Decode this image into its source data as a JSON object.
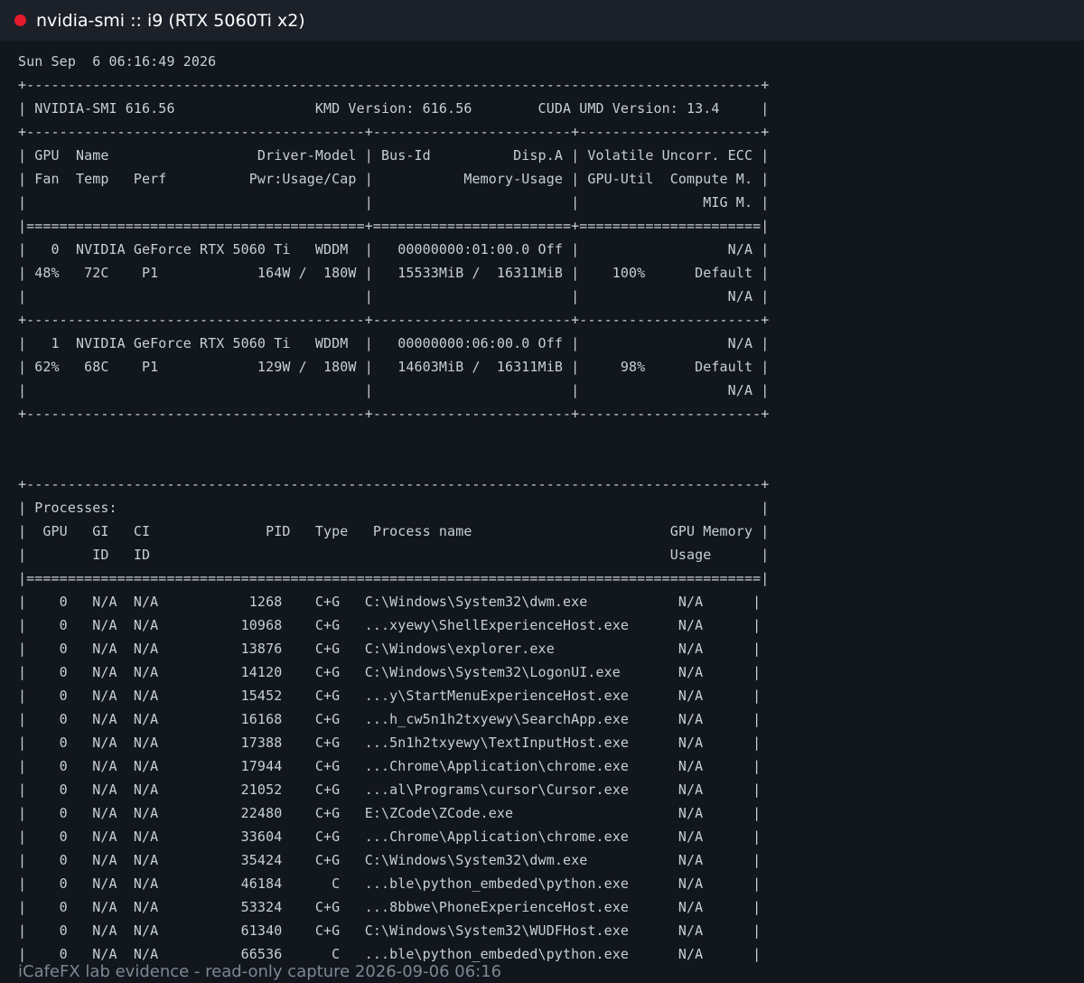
{
  "window": {
    "title": "nvidia-smi :: i9 (RTX 5060Ti x2)"
  },
  "terminal": {
    "lines": [
      "Sun Sep  6 06:16:49 2026",
      "+-----------------------------------------------------------------------------------------+",
      "| NVIDIA-SMI 616.56                 KMD Version: 616.56        CUDA UMD Version: 13.4     |",
      "+-----------------------------------------+------------------------+----------------------+",
      "| GPU  Name                  Driver-Model | Bus-Id          Disp.A | Volatile Uncorr. ECC |",
      "| Fan  Temp   Perf          Pwr:Usage/Cap |           Memory-Usage | GPU-Util  Compute M. |",
      "|                                         |                        |               MIG M. |",
      "|=========================================+========================+======================|",
      "|   0  NVIDIA GeForce RTX 5060 Ti   WDDM  |   00000000:01:00.0 Off |                  N/A |",
      "| 48%   72C    P1            164W /  180W |   15533MiB /  16311MiB |    100%      Default |",
      "|                                         |                        |                  N/A |",
      "+-----------------------------------------+------------------------+----------------------+",
      "|   1  NVIDIA GeForce RTX 5060 Ti   WDDM  |   00000000:06:00.0 Off |                  N/A |",
      "| 62%   68C    P1            129W /  180W |   14603MiB /  16311MiB |     98%      Default |",
      "|                                         |                        |                  N/A |",
      "+-----------------------------------------+------------------------+----------------------+",
      "",
      "",
      "+-----------------------------------------------------------------------------------------+",
      "| Processes:                                                                              |",
      "|  GPU   GI   CI              PID   Type   Process name                        GPU Memory |",
      "|        ID   ID                                                               Usage      |",
      "|=========================================================================================|",
      "|    0   N/A  N/A           1268    C+G   C:\\Windows\\System32\\dwm.exe           N/A      |",
      "|    0   N/A  N/A          10968    C+G   ...xyewy\\ShellExperienceHost.exe      N/A      |",
      "|    0   N/A  N/A          13876    C+G   C:\\Windows\\explorer.exe               N/A      |",
      "|    0   N/A  N/A          14120    C+G   C:\\Windows\\System32\\LogonUI.exe       N/A      |",
      "|    0   N/A  N/A          15452    C+G   ...y\\StartMenuExperienceHost.exe      N/A      |",
      "|    0   N/A  N/A          16168    C+G   ...h_cw5n1h2txyewy\\SearchApp.exe      N/A      |",
      "|    0   N/A  N/A          17388    C+G   ...5n1h2txyewy\\TextInputHost.exe      N/A      |",
      "|    0   N/A  N/A          17944    C+G   ...Chrome\\Application\\chrome.exe      N/A      |",
      "|    0   N/A  N/A          21052    C+G   ...al\\Programs\\cursor\\Cursor.exe      N/A      |",
      "|    0   N/A  N/A          22480    C+G   E:\\ZCode\\ZCode.exe                    N/A      |",
      "|    0   N/A  N/A          33604    C+G   ...Chrome\\Application\\chrome.exe      N/A      |",
      "|    0   N/A  N/A          35424    C+G   C:\\Windows\\System32\\dwm.exe           N/A      |",
      "|    0   N/A  N/A          46184      C   ...ble\\python_embeded\\python.exe      N/A      |",
      "|    0   N/A  N/A          53324    C+G   ...8bbwe\\PhoneExperienceHost.exe      N/A      |",
      "|    0   N/A  N/A          61340    C+G   C:\\Windows\\System32\\WUDFHost.exe      N/A      |",
      "|    0   N/A  N/A          66536      C   ...ble\\python_embeded\\python.exe      N/A      |"
    ]
  },
  "footer": {
    "caption": "iCafeFX lab evidence - read-only capture 2026-09-06 06:16"
  },
  "colors": {
    "background": "#12161d",
    "titlebar": "#1b2029",
    "record_dot": "#e3192c",
    "terminal_text": "#c9cfd6",
    "footer_text": "#7f8792"
  }
}
